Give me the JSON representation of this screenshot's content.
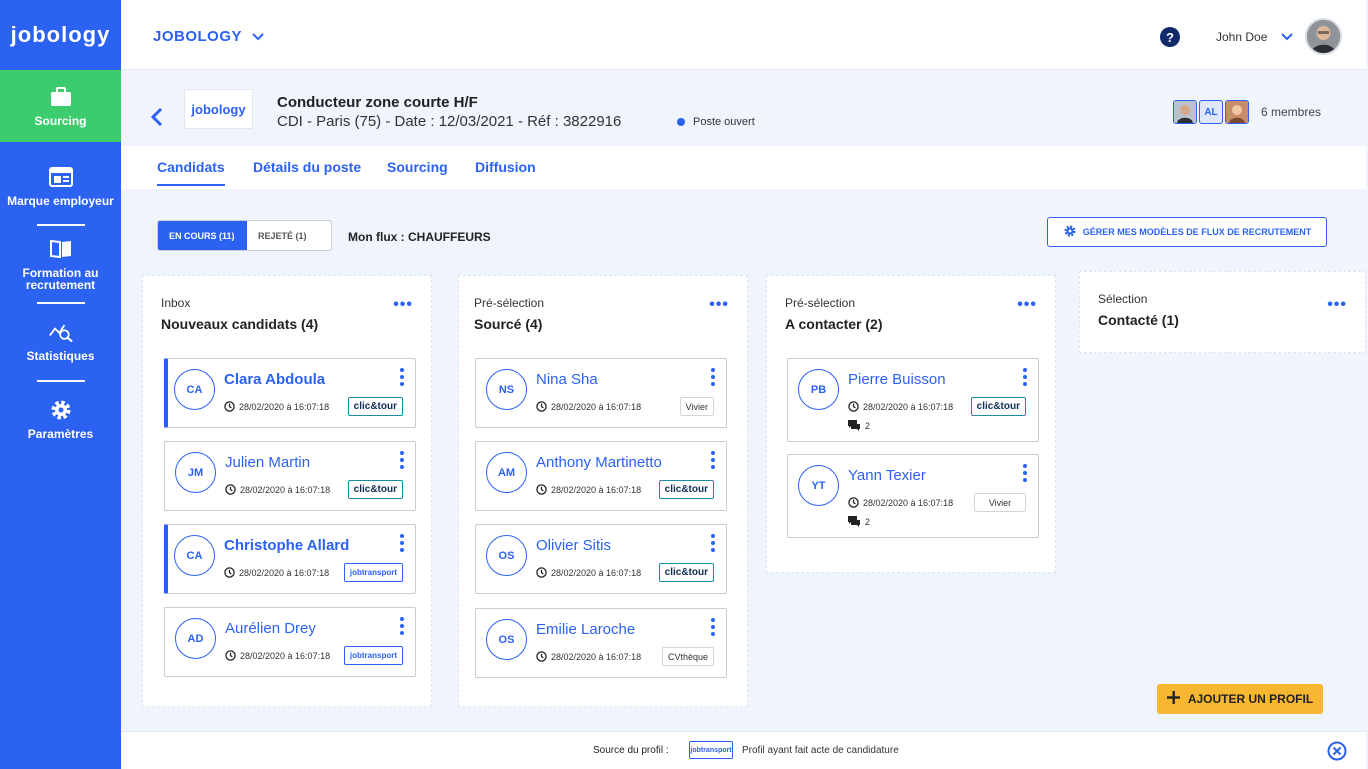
{
  "app": {
    "logo": "jobology",
    "company_selector": "JOBOLOGY",
    "user_name": "John Doe",
    "help": "?"
  },
  "sidebar": {
    "items": [
      {
        "label": "Sourcing",
        "icon": "briefcase-icon",
        "active": true
      },
      {
        "label": "Marque employeur",
        "icon": "browser-window-icon",
        "active": false
      },
      {
        "label": "Formation au recrutement",
        "icon": "book-icon",
        "active": false
      },
      {
        "label": "Statistiques",
        "icon": "chart-search-icon",
        "active": false
      },
      {
        "label": "Paramètres",
        "icon": "gear-icon",
        "active": false
      }
    ]
  },
  "job": {
    "logo_text": "jobology",
    "title": "Conducteur zone courte H/F",
    "subtitle": "CDI - Paris (75) - Date : 12/03/2021 - Réf : 3822916",
    "status": "Poste ouvert",
    "member_initials": "AL",
    "members_label": "6 membres"
  },
  "tabs": [
    {
      "label": "Candidats",
      "active": true
    },
    {
      "label": "Détails du poste",
      "active": false
    },
    {
      "label": "Sourcing",
      "active": false
    },
    {
      "label": "Diffusion",
      "active": false
    }
  ],
  "filters": {
    "in_progress": "EN COURS (11)",
    "rejected": "REJETÉ (1)",
    "flux_label": "Mon flux : CHAUFFEURS",
    "manage_button": "GÉRER MES MODÈLES DE FLUX DE RECRUTEMENT"
  },
  "columns": [
    {
      "kicker": "Inbox",
      "title": "Nouveaux candidats (4)",
      "cards": [
        {
          "initials": "CA",
          "name": "Clara Abdoula",
          "date": "28/02/2020 à 16:07:18",
          "source": "clic&tour",
          "source_type": "clic",
          "highlight": true
        },
        {
          "initials": "JM",
          "name": "Julien Martin",
          "date": "28/02/2020 à 16:07:18",
          "source": "clic&tour",
          "source_type": "clic",
          "highlight": false
        },
        {
          "initials": "CA",
          "name": "Christophe Allard",
          "date": "28/02/2020 à 16:07:18",
          "source": "jobtransport",
          "source_type": "jobt",
          "highlight": true
        },
        {
          "initials": "AD",
          "name": "Aurélien Drey",
          "date": "28/02/2020 à 16:07:18",
          "source": "jobtransport",
          "source_type": "jobt",
          "highlight": false
        }
      ]
    },
    {
      "kicker": "Pré-sélection",
      "title": "Sourcé (4)",
      "cards": [
        {
          "initials": "NS",
          "name": "Nina Sha",
          "date": "28/02/2020 à 16:07:18",
          "source": "Vivier",
          "source_type": "plain",
          "highlight": false
        },
        {
          "initials": "AM",
          "name": "Anthony Martinetto",
          "date": "28/02/2020 à 16:07:18",
          "source": "clic&tour",
          "source_type": "clic",
          "highlight": false
        },
        {
          "initials": "OS",
          "name": "Olivier Sitis",
          "date": "28/02/2020 à 16:07:18",
          "source": "clic&tour",
          "source_type": "clic",
          "highlight": false
        },
        {
          "initials": "OS",
          "name": "Emilie Laroche",
          "date": "28/02/2020 à 16:07:18",
          "source": "CVthèque",
          "source_type": "plain",
          "highlight": false
        }
      ]
    },
    {
      "kicker": "Pré-sélection",
      "title": "A contacter (2)",
      "cards": [
        {
          "initials": "PB",
          "name": "Pierre Buisson",
          "date": "28/02/2020 à 16:07:18",
          "source": "clic&tour",
          "source_type": "clic",
          "highlight": false,
          "messages": "2"
        },
        {
          "initials": "YT",
          "name": "Yann Texier",
          "date": "28/02/2020 à 16:07:18",
          "source": "Vivier",
          "source_type": "plain",
          "highlight": false,
          "messages": "2"
        }
      ]
    },
    {
      "kicker": "Sélection",
      "title": "Contacté (1)",
      "cards": []
    }
  ],
  "add_profile": "AJOUTER UN PROFIL",
  "footer": {
    "label": "Source du profil :",
    "tag": "jobtransport",
    "text": "Profil ayant fait acte de candidature"
  },
  "colors": {
    "primary": "#2c62f1",
    "active_sidebar": "#3ccc6e",
    "cta": "#f7b731"
  }
}
